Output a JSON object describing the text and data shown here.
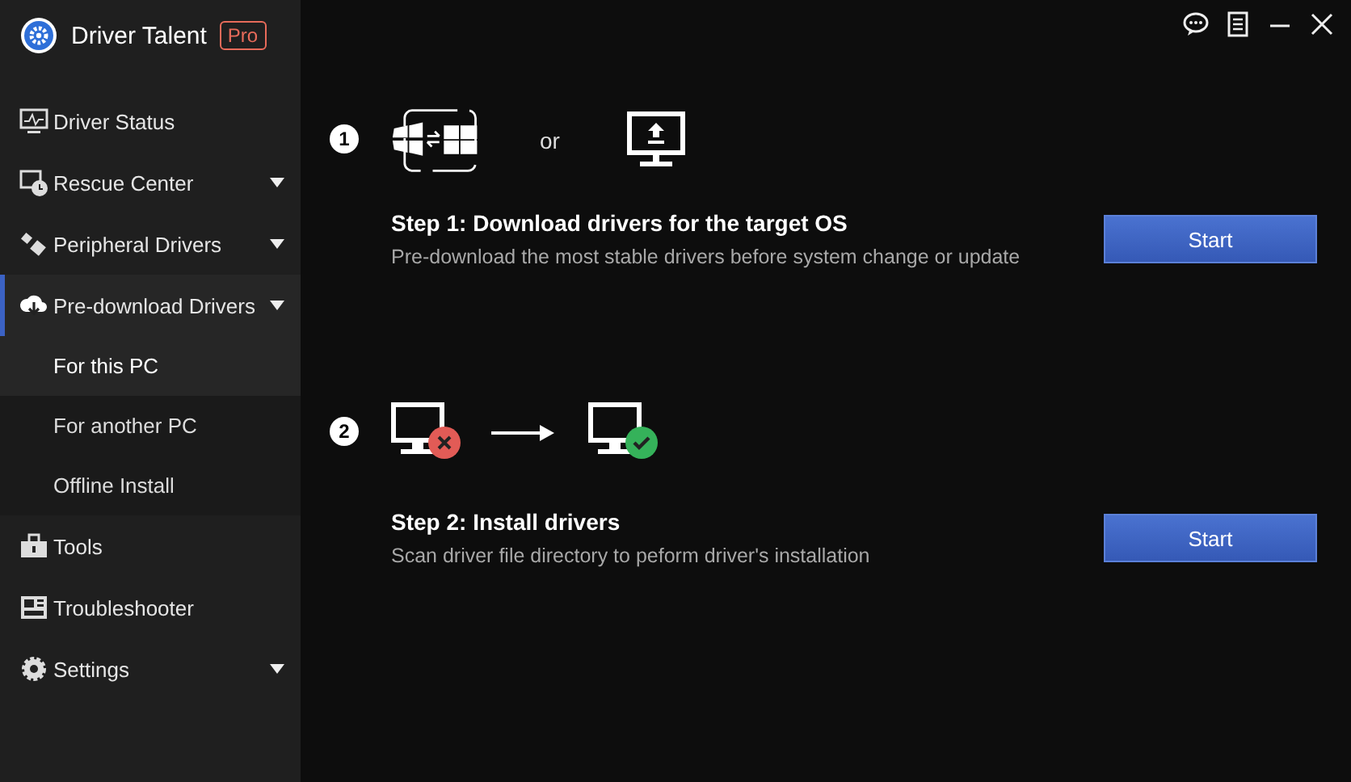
{
  "app": {
    "title": "Driver Talent",
    "badge": "Pro"
  },
  "nav": [
    {
      "label": "Driver Status",
      "selected": false,
      "has_menu": false
    },
    {
      "label": "Rescue Center",
      "selected": false,
      "has_menu": true
    },
    {
      "label": "Peripheral Drivers",
      "selected": false,
      "has_menu": true
    },
    {
      "label": "Pre-download Drivers",
      "selected": true,
      "has_menu": true,
      "children": [
        {
          "label": "For this PC",
          "selected": true
        },
        {
          "label": "For another PC",
          "selected": false
        },
        {
          "label": "Offline Install",
          "selected": false
        }
      ]
    },
    {
      "label": "Tools",
      "selected": false,
      "has_menu": false
    },
    {
      "label": "Troubleshooter",
      "selected": false,
      "has_menu": false
    },
    {
      "label": "Settings",
      "selected": false,
      "has_menu": true
    }
  ],
  "steps": [
    {
      "number": "1",
      "or_text": "or",
      "title": "Step 1: Download drivers for the target OS",
      "description": "Pre-download the most stable drivers before system change or update",
      "button": "Start"
    },
    {
      "number": "2",
      "title": "Step 2: Install drivers",
      "description": "Scan driver file directory to peform driver's installation",
      "button": "Start"
    }
  ]
}
